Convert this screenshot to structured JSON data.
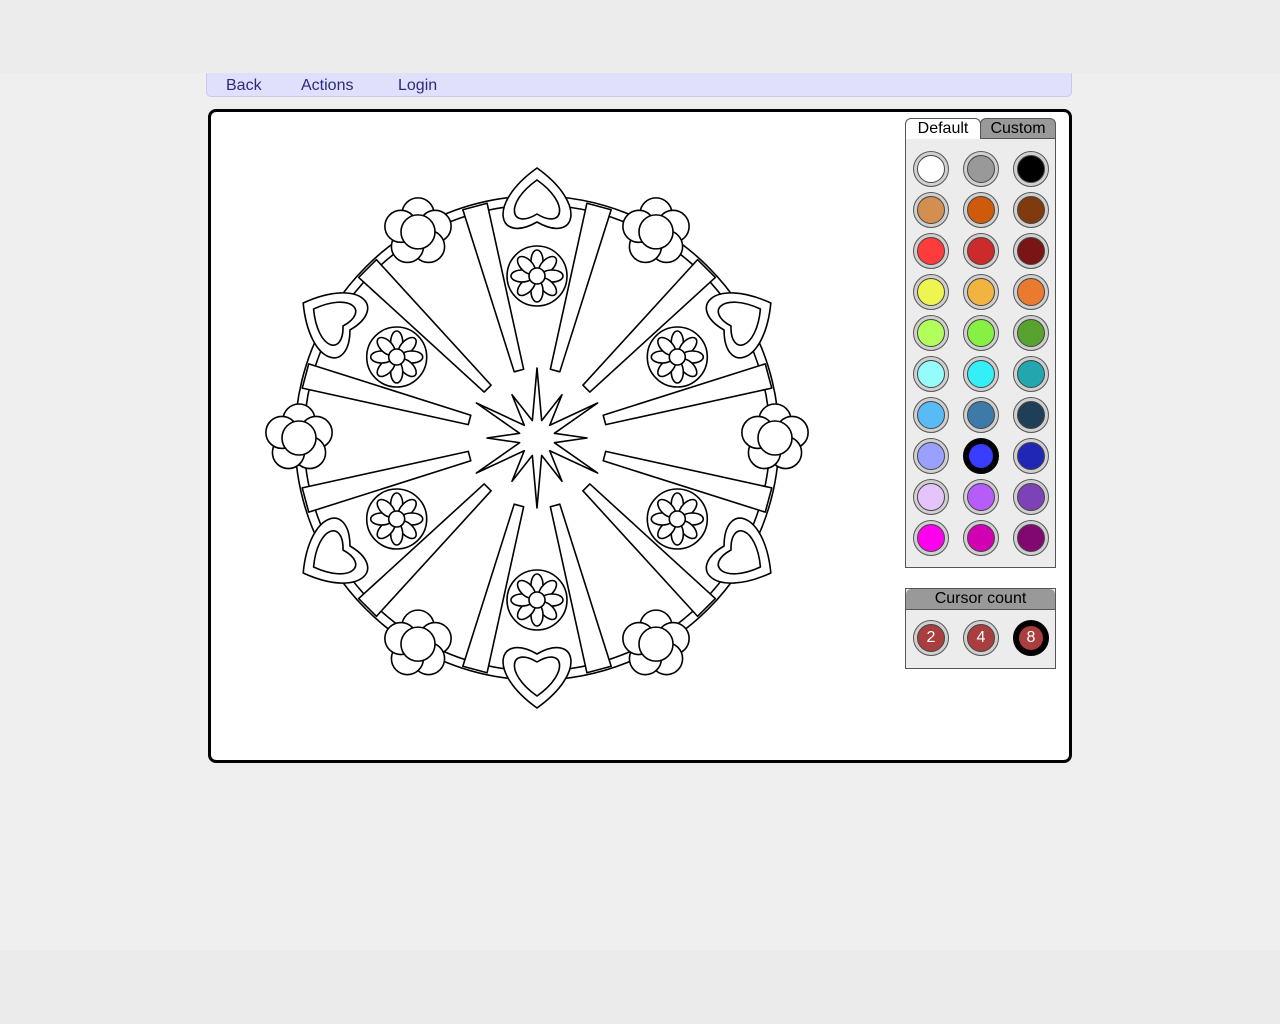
{
  "menu": {
    "items": [
      {
        "label": "Back"
      },
      {
        "label": "Actions"
      },
      {
        "label": "Login"
      }
    ]
  },
  "palette": {
    "tabs": [
      {
        "label": "Default",
        "active": true
      },
      {
        "label": "Custom",
        "active": false
      }
    ],
    "selected_color": "#3a3cff",
    "colors": [
      [
        "#ffffff",
        "#999999",
        "#000000"
      ],
      [
        "#d28f50",
        "#d05a0c",
        "#7f3b0d"
      ],
      [
        "#ff3b3b",
        "#cc2b2b",
        "#7a1515"
      ],
      [
        "#eef551",
        "#f2b441",
        "#ea7a2f"
      ],
      [
        "#b2ff5c",
        "#86f143",
        "#58a330"
      ],
      [
        "#96fbfb",
        "#34f0f6",
        "#21a7ad"
      ],
      [
        "#58bbf5",
        "#3d7aa8",
        "#1f3f58"
      ],
      [
        "#9aa0ff",
        "#3a3cff",
        "#2127b5"
      ],
      [
        "#e5c4fb",
        "#b65cf8",
        "#7e42b8"
      ],
      [
        "#ff00ee",
        "#d100b2",
        "#800870"
      ]
    ]
  },
  "cursor_count": {
    "title": "Cursor count",
    "options": [
      "2",
      "4",
      "8"
    ],
    "selected": "8",
    "button_color": "#a83e3e"
  }
}
